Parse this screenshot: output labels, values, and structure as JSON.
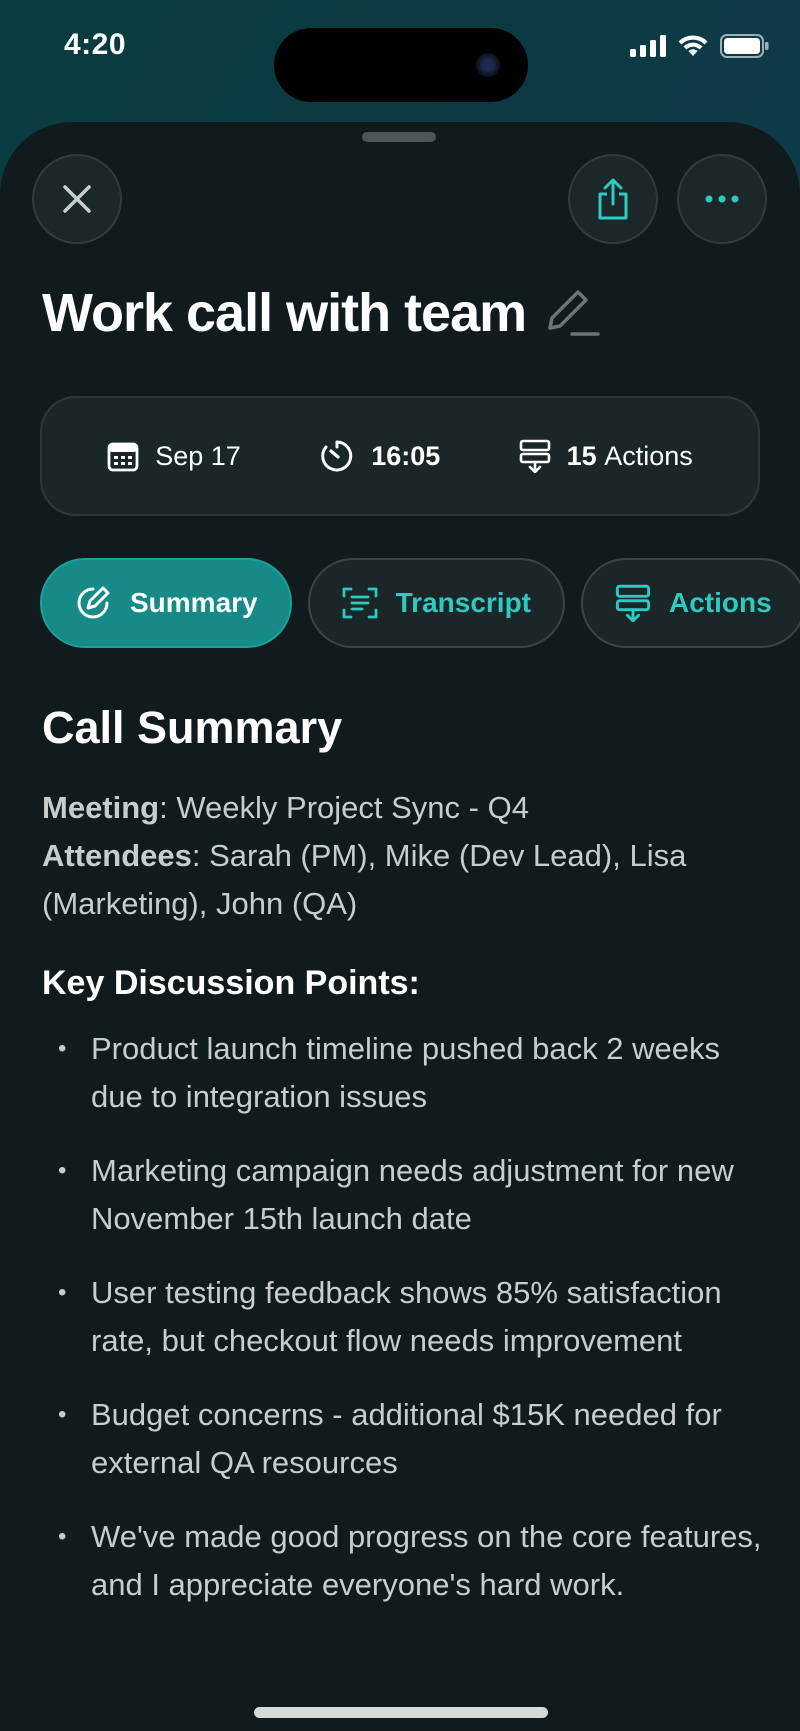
{
  "status_bar": {
    "time": "4:20"
  },
  "header": {
    "title": "Work call with team",
    "close_icon": "close-icon",
    "share_icon": "share-icon",
    "more_icon": "more-icon",
    "edit_icon": "pencil-icon"
  },
  "info": {
    "date": "Sep 17",
    "duration": "16:05",
    "actions_count": "15",
    "actions_label": "Actions"
  },
  "tabs": [
    {
      "label": "Summary",
      "icon": "summary-icon",
      "active": true
    },
    {
      "label": "Transcript",
      "icon": "transcript-icon",
      "active": false
    },
    {
      "label": "Actions",
      "icon": "actions-icon",
      "active": false
    }
  ],
  "summary": {
    "heading": "Call Summary",
    "meeting_label": "Meeting",
    "meeting_value": ": Weekly Project Sync - Q4",
    "attendees_label": "Attendees",
    "attendees_value": ": Sarah (PM), Mike (Dev Lead), Lisa (Marketing), John (QA)",
    "key_points_heading": "Key Discussion Points:",
    "points": [
      "Product launch timeline pushed back 2 weeks due to integration issues",
      "Marketing campaign needs adjustment for new November 15th launch date",
      "User testing feedback shows 85% satisfaction rate, but checkout flow needs improvement",
      "Budget concerns - additional $15K needed for external QA resources",
      "We've made good progress on the core features, and I appreciate everyone's hard work."
    ]
  },
  "colors": {
    "accent": "#168a87",
    "accent_text": "#2ec9bf",
    "sheet_bg": "#111b1d"
  }
}
